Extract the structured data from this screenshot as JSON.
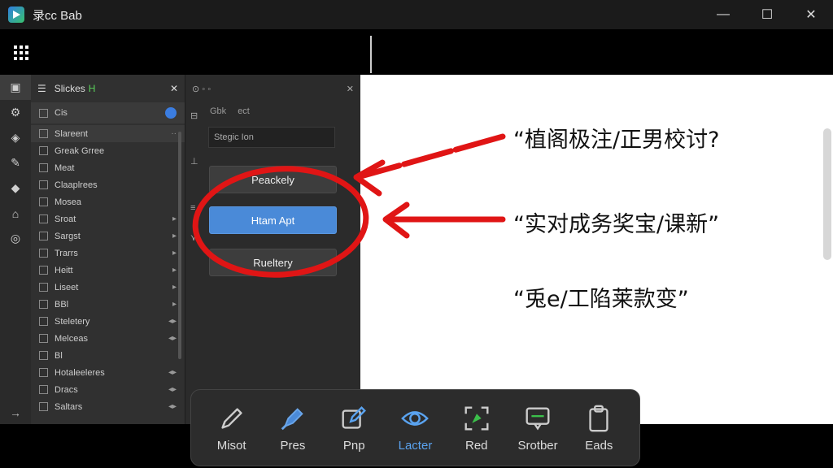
{
  "window": {
    "title": "录cc Bab",
    "minimize": "—",
    "maximize": "☐",
    "close": "✕"
  },
  "sidebar": {
    "header_label": "Slickes",
    "header_accent": "H",
    "close": "✕",
    "items": [
      {
        "label": "Cis",
        "trail": ""
      },
      {
        "label": "Slareent",
        "trail": "··"
      },
      {
        "label": "Greak Grree",
        "trail": ""
      },
      {
        "label": "Meat",
        "trail": ""
      },
      {
        "label": "Claaplrees",
        "trail": ""
      },
      {
        "label": "Mosea",
        "trail": ""
      },
      {
        "label": "Sroat",
        "trail": "▸"
      },
      {
        "label": "Sargst",
        "trail": "▸"
      },
      {
        "label": "Trarrs",
        "trail": "▸"
      },
      {
        "label": "Heitt",
        "trail": "▸"
      },
      {
        "label": "Liseet",
        "trail": "▸"
      },
      {
        "label": "BBl",
        "trail": "▸"
      },
      {
        "label": "Steletery",
        "trail": "◂▸"
      },
      {
        "label": "Melceas",
        "trail": "◂▸"
      },
      {
        "label": "Bl",
        "trail": ""
      },
      {
        "label": "Hotaleeleres",
        "trail": "◂▸"
      },
      {
        "label": "Dracs",
        "trail": "◂▸"
      },
      {
        "label": "Saltars",
        "trail": "◂▸"
      }
    ]
  },
  "panel": {
    "tabs": [
      "Gbk",
      "ect"
    ],
    "field_placeholder": "Stegic Ion",
    "buttons": [
      "Peackely",
      "Htam Apt",
      "Rueltery"
    ]
  },
  "canvas": {
    "notes": [
      "“植阁极注/正男校讨?",
      "“实对成务奖宝/课新”",
      "“兎e/工陷莱款变”"
    ]
  },
  "tools": [
    {
      "label": "Misot",
      "icon": "pen-icon"
    },
    {
      "label": "Pres",
      "icon": "highlighter-icon"
    },
    {
      "label": "Pnp",
      "icon": "edit-square-icon"
    },
    {
      "label": "Lacter",
      "icon": "eye-icon"
    },
    {
      "label": "Red",
      "icon": "crop-icon"
    },
    {
      "label": "Srotber",
      "icon": "message-icon"
    },
    {
      "label": "Eads",
      "icon": "clipboard-icon"
    }
  ],
  "colors": {
    "annotation_red": "#e01515",
    "accent_blue": "#4a8ad8",
    "active_tool": "#5aa3f0"
  }
}
